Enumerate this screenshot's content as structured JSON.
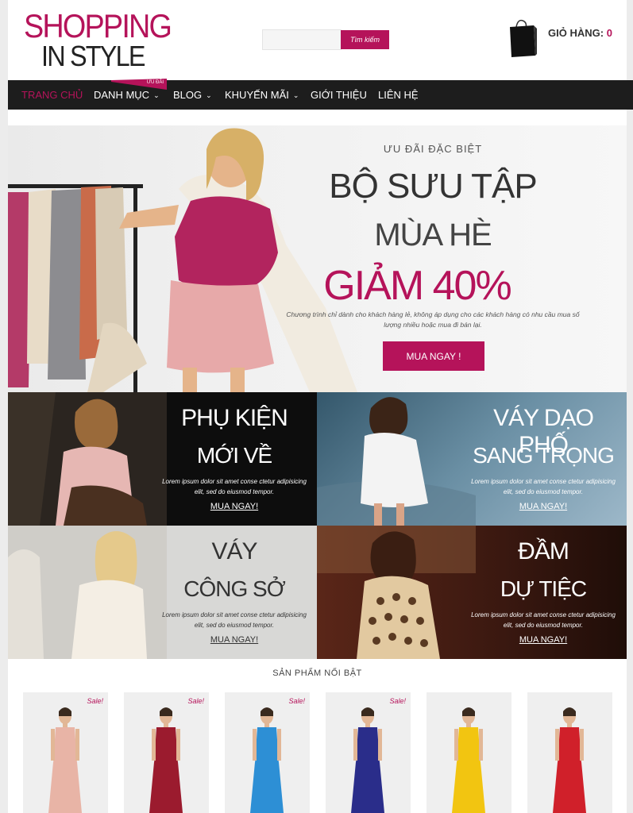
{
  "header": {
    "logo_line1": "SHOPPING",
    "logo_line2": "IN STYLE",
    "search_placeholder": "",
    "search_button": "Tìm kiếm",
    "cart_label": "GIỎ HÀNG:",
    "cart_count": "0"
  },
  "nav": {
    "items": [
      {
        "label": "TRANG CHỦ",
        "active": true
      },
      {
        "label": "DANH MỤC",
        "dropdown": true
      },
      {
        "label": "BLOG",
        "dropdown": true
      },
      {
        "label": "KHUYẾN MÃI",
        "dropdown": true
      },
      {
        "label": "GIỚI THIỆU"
      },
      {
        "label": "LIÊN HỆ"
      }
    ],
    "promo_tag": "ƯU ĐÃI"
  },
  "hero": {
    "tagline": "ƯU ĐÃI ĐẶC BIỆT",
    "title1": "BỘ SƯU TẬP",
    "title2": "MÙA HÈ",
    "title3": "GIẢM 40%",
    "description": "Chương trình chỉ dành cho khách hàng lẻ, không áp dụng cho các khách hàng có nhu cầu mua số lượng nhiều hoặc mua đi bán lại.",
    "button": "MUA NGAY !"
  },
  "tiles": [
    {
      "line1": "PHỤ KIỆN",
      "line2": "MỚI VỀ",
      "desc": "Lorem ipsum dolor sit amet conse ctetur adipisicing elit, sed do eiusmod tempor.",
      "button": "MUA NGAY!"
    },
    {
      "line1": "VÁY DẠO PHỐ",
      "line2": "SANG TRỌNG",
      "desc": "Lorem ipsum dolor sit amet conse ctetur adipisicing elit, sed do eiusmod tempor.",
      "button": "MUA NGAY!"
    },
    {
      "line1": "VÁY",
      "line2": "CÔNG SỞ",
      "desc": "Lorem ipsum dolor sit amet conse ctetur adipisicing elit, sed do eiusmod tempor.",
      "button": "MUA NGAY!"
    },
    {
      "line1": "ĐẦM",
      "line2": "DỰ TIỆC",
      "desc": "Lorem ipsum dolor sit amet conse ctetur adipisicing elit, sed do eiusmod tempor.",
      "button": "MUA NGAY!"
    }
  ],
  "featured": {
    "title": "SẢN PHẨM NỔI BẬT",
    "sale_label": "Sale!",
    "products": [
      {
        "sale": true,
        "color": "#e8b4a6"
      },
      {
        "sale": true,
        "color": "#9b1b2e"
      },
      {
        "sale": true,
        "color": "#2d8fd5"
      },
      {
        "sale": true,
        "color": "#2a2d8a"
      },
      {
        "sale": false,
        "color": "#f2c511"
      },
      {
        "sale": false,
        "color": "#d0202a"
      }
    ]
  },
  "colors": {
    "brand": "#b5135a",
    "nav_bg": "#1d1d1d"
  }
}
